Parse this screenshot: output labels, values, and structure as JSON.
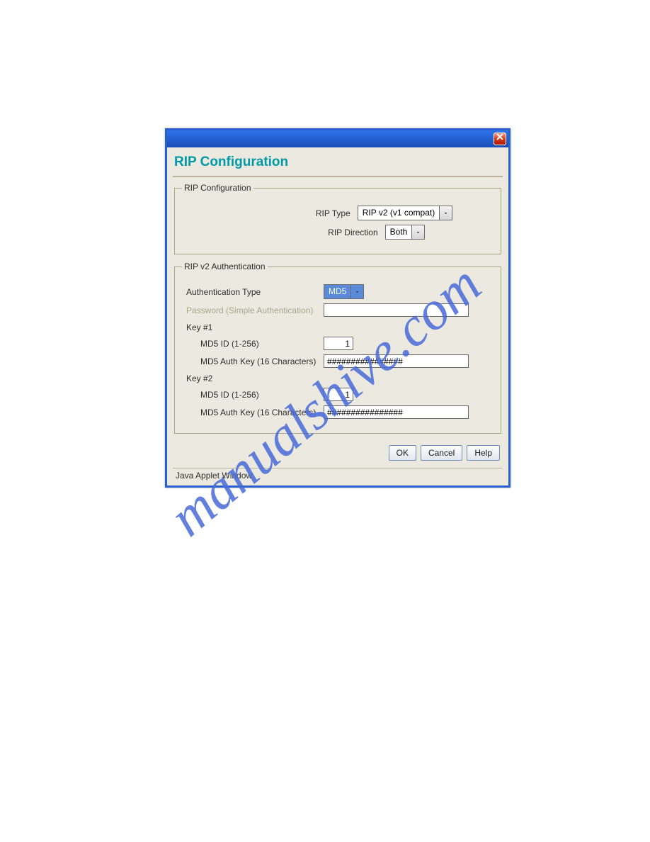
{
  "dialog": {
    "title": "RIP Configuration",
    "sections": {
      "config": {
        "legend": "RIP Configuration",
        "rip_type_label": "RIP Type",
        "rip_type_value": "RIP v2 (v1 compat)",
        "rip_direction_label": "RIP Direction",
        "rip_direction_value": "Both"
      },
      "auth": {
        "legend": "RIP v2 Authentication",
        "auth_type_label": "Authentication Type",
        "auth_type_value": "MD5",
        "password_label": "Password (Simple Authentication)",
        "password_value": "",
        "key1": {
          "header": "Key #1",
          "id_label": "MD5 ID (1-256)",
          "id_value": "1",
          "key_label": "MD5 Auth Key (16 Characters)",
          "key_value": "################"
        },
        "key2": {
          "header": "Key #2",
          "id_label": "MD5 ID (1-256)",
          "id_value": "1",
          "key_label": "MD5 Auth Key (16 Characters)",
          "key_value": "################"
        }
      }
    },
    "buttons": {
      "ok": "OK",
      "cancel": "Cancel",
      "help": "Help"
    },
    "status": "Java Applet Window"
  },
  "watermark": "manualshive.com"
}
